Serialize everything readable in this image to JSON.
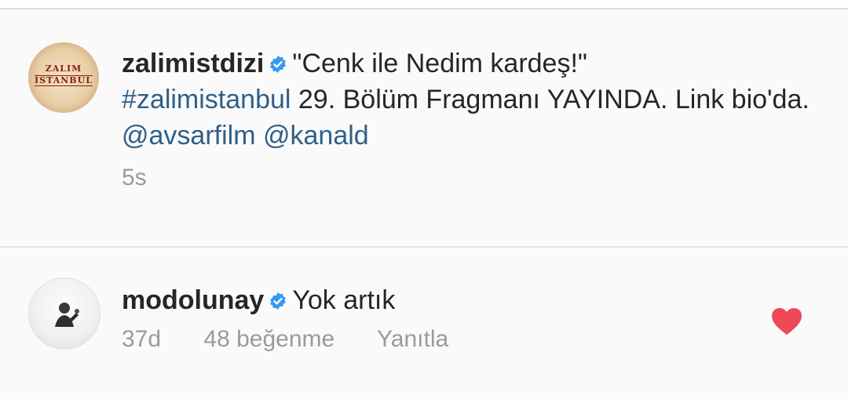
{
  "caption": {
    "username": "zalimistdizi",
    "avatar_text_line1": "ZALIM",
    "avatar_text_line2": "İSTANBUL",
    "text_quote": "\"Cenk ile Nedim kardeş!\"",
    "hashtag": "#zalimistanbul",
    "text_body": " 29. Bölüm Fragmanı YAYINDA. Link bio'da. ",
    "mention1": "@avsarfilm",
    "mention2": "@kanald",
    "time": "5s"
  },
  "reply": {
    "username": "modolunay",
    "text": "Yok artık",
    "time": "37d",
    "likes": "48 beğenme",
    "reply_label": "Yanıtla",
    "liked": true
  },
  "colors": {
    "link": "#2f5f8a",
    "verified": "#3897f0",
    "heart": "#ed4956",
    "meta": "#9a9a9a"
  }
}
